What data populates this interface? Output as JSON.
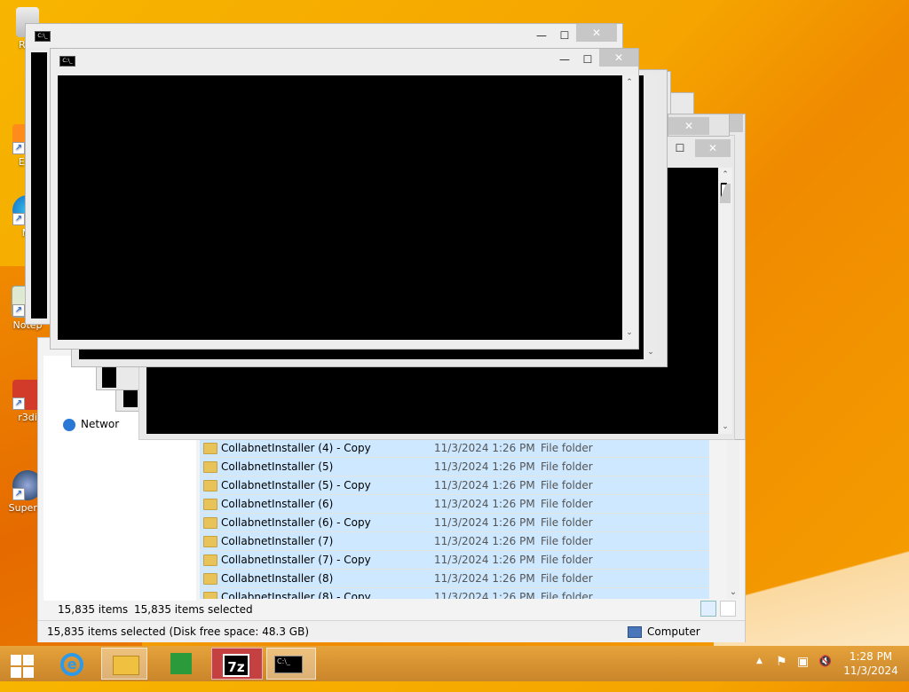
{
  "desktop": {
    "icons": [
      {
        "label": "Rec",
        "icon": "recycle-bin-icon"
      },
      {
        "label": "Eve",
        "icon": "everything-icon"
      },
      {
        "label": "Mi",
        "icon": "edge-icon"
      },
      {
        "label": "Notep",
        "icon": "notepad-icon"
      },
      {
        "label": "r3di",
        "icon": "r3di-icon"
      },
      {
        "label": "Superm",
        "icon": "supermium-icon"
      }
    ]
  },
  "explorer": {
    "nav": {
      "network_label": "Networ"
    },
    "files": [
      {
        "name": "CollabnetInstaller (4) - Copy",
        "date": "11/3/2024 1:26 PM",
        "type": "File folder"
      },
      {
        "name": "CollabnetInstaller (5)",
        "date": "11/3/2024 1:26 PM",
        "type": "File folder"
      },
      {
        "name": "CollabnetInstaller (5) - Copy",
        "date": "11/3/2024 1:26 PM",
        "type": "File folder"
      },
      {
        "name": "CollabnetInstaller (6)",
        "date": "11/3/2024 1:26 PM",
        "type": "File folder"
      },
      {
        "name": "CollabnetInstaller (6) - Copy",
        "date": "11/3/2024 1:26 PM",
        "type": "File folder"
      },
      {
        "name": "CollabnetInstaller (7)",
        "date": "11/3/2024 1:26 PM",
        "type": "File folder"
      },
      {
        "name": "CollabnetInstaller (7) - Copy",
        "date": "11/3/2024 1:26 PM",
        "type": "File folder"
      },
      {
        "name": "CollabnetInstaller (8)",
        "date": "11/3/2024 1:26 PM",
        "type": "File folder"
      },
      {
        "name": "CollabnetInstaller (8) - Copy",
        "date": "11/3/2024 1:26 PM",
        "type": "File folder"
      }
    ],
    "item_count": "15,835 items",
    "selected_count": "15,835 items selected",
    "status_text": "15,835 items selected (Disk free space: 48.3 GB)",
    "location_label": "Computer"
  },
  "console_windows": {
    "minimize_glyph": "—",
    "maximize_glyph": "☐",
    "close_glyph": "✕",
    "icon_text": "C:\\_"
  },
  "taskbar": {
    "apps": [
      "start-button",
      "internet-explorer",
      "file-explorer",
      "store",
      "7-zip",
      "command-prompt"
    ],
    "zip_label": "7z",
    "tray": {
      "show_hidden_glyph": "▲",
      "flag_glyph": "⚑",
      "network_glyph": "▣",
      "volume_glyph": "🔇"
    },
    "time": "1:28 PM",
    "date": "11/3/2024"
  }
}
